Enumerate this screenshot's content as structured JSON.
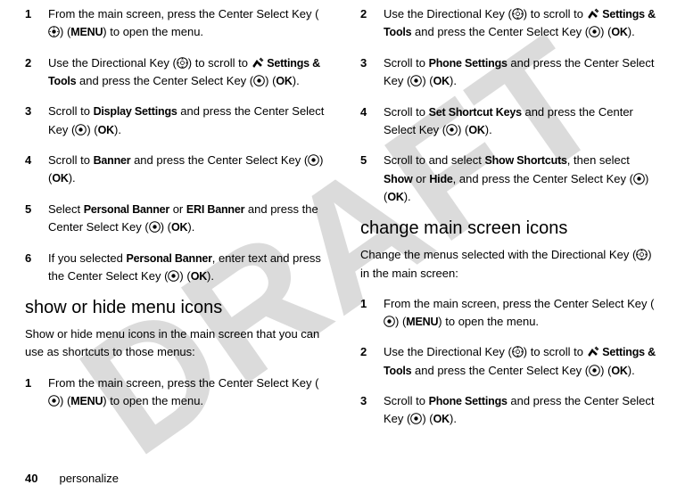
{
  "watermark": "DRAFT",
  "footer": {
    "page_number": "40",
    "section": "personalize"
  },
  "icons": {
    "center_select": "center-select-key-icon",
    "directional": "directional-key-icon",
    "settings_tools": "settings-tools-icon"
  },
  "labels": {
    "menu": "MENU",
    "ok": "OK",
    "settings_tools": "Settings & Tools",
    "display_settings": "Display Settings",
    "banner": "Banner",
    "personal_banner": "Personal Banner",
    "eri_banner": "ERI Banner",
    "phone_settings": "Phone Settings",
    "set_shortcut_keys": "Set Shortcut Keys",
    "show_shortcuts": "Show Shortcuts",
    "show": "Show",
    "hide": "Hide"
  },
  "left": {
    "steps_a": [
      {
        "n": "1",
        "pre": "From the main screen, press the Center Select Key (",
        "post_icon": ") (",
        "bold": "MENU",
        "tail": ") to open the menu."
      },
      {
        "n": "2",
        "pre": "Use the Directional Key (",
        "post_icon": ") to scroll to ",
        "tool_prefix": true,
        "bold": "Settings & Tools",
        "mid": " and press the Center Select Key (",
        "bold2": "OK",
        "tail": ")."
      },
      {
        "n": "3",
        "pre": "Scroll to ",
        "bold": "Display Settings",
        "mid": " and press the Center Select Key (",
        "bold2": "OK",
        "tail": ")."
      },
      {
        "n": "4",
        "pre": "Scroll to ",
        "bold": "Banner",
        "mid": " and press the Center Select Key (",
        "bold2": "OK",
        "tail": ")."
      },
      {
        "n": "5",
        "pre": "Select ",
        "bold": "Personal Banner",
        "mid_or": " or ",
        "bold_alt": "ERI Banner",
        "mid": " and press the Center Select Key (",
        "bold2": "OK",
        "tail": ")."
      },
      {
        "n": "6",
        "pre": "If you selected ",
        "bold": "Personal Banner",
        "mid": ", enter text and press the Center Select Key (",
        "bold2": "OK",
        "tail": ")."
      }
    ],
    "heading": "show or hide menu icons",
    "intro": "Show or hide menu icons in the main screen that you can use as shortcuts to those menus:",
    "steps_b": [
      {
        "n": "1",
        "pre": "From the main screen, press the Center Select Key (",
        "post_icon": ") (",
        "bold": "MENU",
        "tail": ") to open the menu."
      }
    ]
  },
  "right": {
    "steps_a": [
      {
        "n": "2",
        "pre": "Use the Directional Key (",
        "post_icon": ") to scroll to ",
        "tool_prefix": true,
        "bold": "Settings & Tools",
        "mid": " and press the Center Select Key (",
        "bold2": "OK",
        "tail": ")."
      },
      {
        "n": "3",
        "pre": "Scroll to ",
        "bold": "Phone Settings",
        "mid": " and press the Center Select Key (",
        "bold2": "OK",
        "tail": ")."
      },
      {
        "n": "4",
        "pre": "Scroll to ",
        "bold": "Set Shortcut Keys",
        "mid": " and press the Center Select Key (",
        "bold2": "OK",
        "tail": ")."
      },
      {
        "n": "5",
        "pre": "Scroll to and select ",
        "bold": "Show Shortcuts",
        "mid_then": ", then select ",
        "bold_alt": "Show",
        "mid_or": " or ",
        "bold_alt2": "Hide",
        "mid": ", and press the Center Select Key (",
        "bold2": "OK",
        "tail": ")."
      }
    ],
    "heading": "change main screen icons",
    "intro": "Change the menus selected with the Directional Key (",
    "intro_tail": ") in the main screen:",
    "steps_b": [
      {
        "n": "1",
        "pre": "From the main screen, press the Center Select Key (",
        "post_icon": ") (",
        "bold": "MENU",
        "tail": ") to open the menu."
      },
      {
        "n": "2",
        "pre": "Use the Directional Key (",
        "post_icon": ") to scroll to ",
        "tool_prefix": true,
        "bold": "Settings & Tools",
        "mid": " and press the Center Select Key (",
        "bold2": "OK",
        "tail": ")."
      },
      {
        "n": "3",
        "pre": "Scroll to ",
        "bold": "Phone Settings",
        "mid": " and press the Center Select Key (",
        "bold2": "OK",
        "tail": ")."
      }
    ]
  }
}
